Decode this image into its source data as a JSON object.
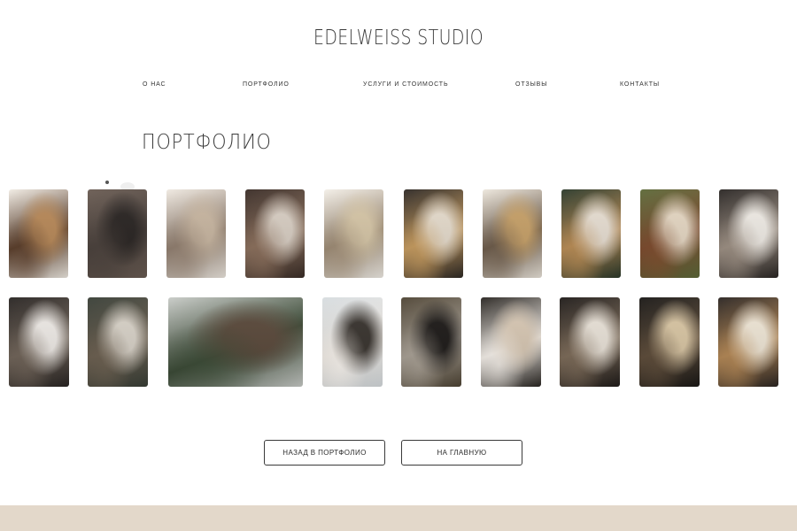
{
  "header": {
    "logo": "EDELWEISS STUDIO",
    "nav": [
      "О НАС",
      "ПОРТФОЛИО",
      "УСЛУГИ И СТОИМОСТЬ",
      "ОТЗЫВЫ",
      "КОНТАКТЫ"
    ]
  },
  "main": {
    "title": "ПОРТФОЛИО",
    "gallery_row1": [
      {
        "subject": "invitation-box",
        "colors": [
          "#f1ece4",
          "#b98a5a",
          "#5a3e2b"
        ]
      },
      {
        "subject": "groom-suit-on-hanger",
        "colors": [
          "#6b5d54",
          "#2b2624",
          "#4a413c"
        ]
      },
      {
        "subject": "bride-veil-flowers",
        "colors": [
          "#efe9e1",
          "#c9b7a2",
          "#8f7d6e"
        ]
      },
      {
        "subject": "bride-portrait-bouquet",
        "colors": [
          "#3b2e28",
          "#d9cfc4",
          "#8a6f5c"
        ]
      },
      {
        "subject": "champagne-toast",
        "colors": [
          "#f3efe8",
          "#d7c7a8",
          "#9c8a74"
        ]
      },
      {
        "subject": "table-dried-flowers",
        "colors": [
          "#2f2a26",
          "#e6dccd",
          "#c49a5f"
        ]
      },
      {
        "subject": "pampas-decor",
        "colors": [
          "#ede7dd",
          "#c8a26a",
          "#6c5b4a"
        ]
      },
      {
        "subject": "floral-arch-sign",
        "colors": [
          "#2c3a2b",
          "#e8dfd3",
          "#b78b55"
        ]
      },
      {
        "subject": "floral-hoop-outdoor",
        "colors": [
          "#5e6a3a",
          "#e6d8c4",
          "#7c4b2e"
        ]
      },
      {
        "subject": "table-setting",
        "colors": [
          "#2b2725",
          "#f0ece6",
          "#9b8e82"
        ]
      }
    ],
    "gallery_row2": [
      {
        "subject": "groom-boutonniere",
        "colors": [
          "#2a2624",
          "#eeeae6",
          "#6f6358"
        ]
      },
      {
        "subject": "couple-umbrella",
        "colors": [
          "#3a4038",
          "#d8d2c8",
          "#6b5f50"
        ]
      },
      {
        "subject": "outdoor-ceremony",
        "colors": [
          "#c9ccc8",
          "#5b4a3c",
          "#3b4a36"
        ]
      },
      {
        "subject": "couple-with-guests",
        "colors": [
          "#d7dcdf",
          "#3a3530",
          "#efeae4"
        ]
      },
      {
        "subject": "umbrella-rain",
        "colors": [
          "#4f4535",
          "#1f1c1a",
          "#a69e93"
        ]
      },
      {
        "subject": "couple-close-up",
        "colors": [
          "#2a2622",
          "#d8c8b4",
          "#f0ebe5"
        ]
      },
      {
        "subject": "couple-dance",
        "colors": [
          "#201c1a",
          "#e9e2d8",
          "#7b6a58"
        ]
      },
      {
        "subject": "bride-under-lights",
        "colors": [
          "#1b1917",
          "#d9c6a4",
          "#5d4c3a"
        ]
      },
      {
        "subject": "wedding-cake",
        "colors": [
          "#2c2623",
          "#efe6d6",
          "#b18655"
        ]
      }
    ]
  },
  "actions": {
    "back_to_portfolio": "НАЗАД В ПОРТФОЛИО",
    "to_home": "НА ГЛАВНУЮ"
  },
  "footer": {
    "band_color": "#e3d8ca"
  }
}
